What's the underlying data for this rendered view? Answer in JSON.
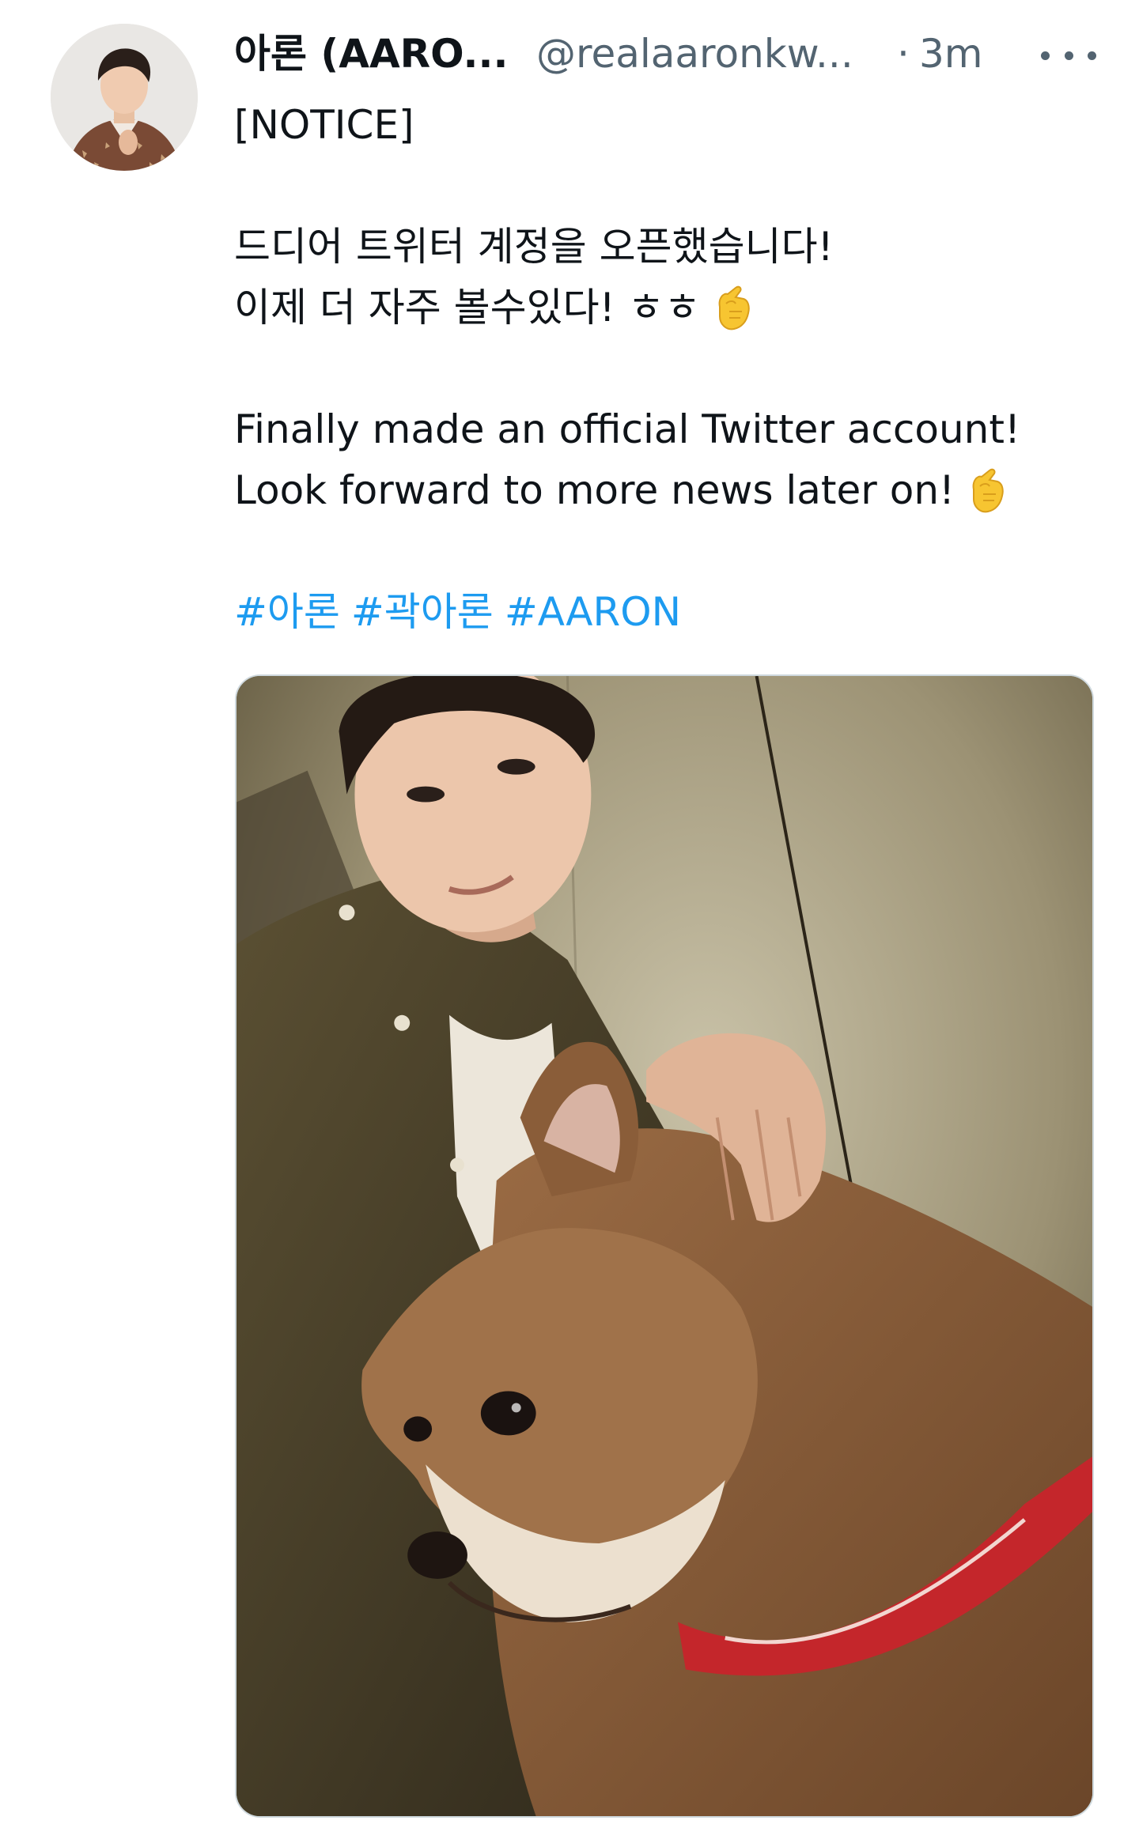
{
  "tweet": {
    "author": {
      "display_name": "아론 (AARO...",
      "handle": "@realaaronkw...",
      "separator": "·",
      "time": "3m"
    },
    "text_lines": [
      "[NOTICE]",
      "",
      "드디어 트위터 계정을 오픈했습니다!",
      "이제 더 자주 볼수있다! ㅎㅎ",
      "",
      "Finally made an official Twitter account!",
      "Look forward to more news later on!"
    ],
    "hashtags": [
      "#아론",
      "#곽아론",
      "#AARON"
    ],
    "icons": {
      "more": "more-options-icon",
      "emoji": "finger-heart-emoji"
    },
    "colors": {
      "link": "#1d9bf0",
      "secondary_text": "#536471",
      "primary_text": "#0f1419",
      "border": "#cfd9de"
    }
  }
}
